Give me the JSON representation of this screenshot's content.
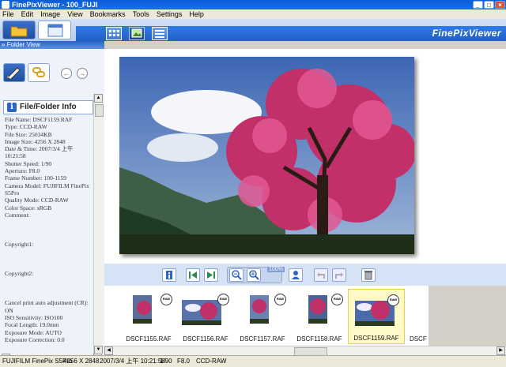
{
  "window": {
    "title": "FinePixViewer - 100_FUJI",
    "min": "_",
    "max": "□",
    "close": "×"
  },
  "menu": [
    "File",
    "Edit",
    "Image",
    "View",
    "Bookmarks",
    "Tools",
    "Settings",
    "Help"
  ],
  "brand": "FinePixViewer",
  "breadcrumb": "» Folder View",
  "info": {
    "title": "File/Folder Info",
    "lines": [
      "File Name: DSCF1159.RAF",
      "Type: CCD-RAW",
      "File Size: 25034KB",
      "Image Size: 4256 X 2848",
      "Date & Time: 2007/3/4 上午",
      "10:21:58",
      "Shutter Speed: 1/90",
      "Aperture: F8.0",
      "Frame Number: 100-1159",
      "Camera Model: FUJIFILM FinePix",
      "S5Pro",
      "Quality Mode: CCD-RAW",
      "Color Space: sRGB",
      "Comment:",
      "",
      "",
      "",
      "Copyright1:",
      "",
      "",
      "",
      "Copyright2:",
      "",
      "",
      "",
      "Cancel print auto adjustment (CR):",
      "ON",
      "ISO Sensitivity: ISO100",
      "Focal Length: 19.0mm",
      "Exposure Mode: AUTO",
      "Exposure Correction: 0.0"
    ]
  },
  "toolbar": {
    "zoom": "100%"
  },
  "thumbs": [
    {
      "name": "DSCF1155.RAF",
      "badge": "RAW"
    },
    {
      "name": "DSCF1156.RAF",
      "badge": "RAW"
    },
    {
      "name": "DSCF1157.RAF",
      "badge": "RAW"
    },
    {
      "name": "DSCF1158.RAF",
      "badge": "RAW"
    },
    {
      "name": "DSCF1159.RAF",
      "badge": "RAW"
    },
    {
      "name": "DSCF",
      "badge": ""
    }
  ],
  "status": {
    "camera": "FUJIFILM FinePix S5Pro",
    "size": "4256 X 2848",
    "datetime": "2007/3/4 上午 10:21:58",
    "shutter": "1/90",
    "aperture": "F8.0",
    "mode": "CCD-RAW"
  }
}
